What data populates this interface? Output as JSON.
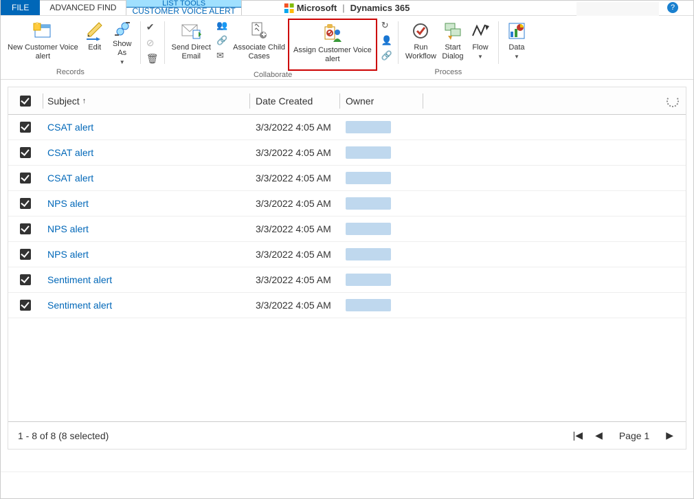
{
  "header": {
    "tabs": {
      "file": "FILE",
      "advanced_find": "ADVANCED FIND",
      "group_title": "LIST TOOLS",
      "group_sub": "CUSTOMER VOICE ALERT"
    },
    "brand": {
      "ms": "Microsoft",
      "product": "Dynamics 365"
    }
  },
  "ribbon": {
    "records": {
      "label": "Records",
      "new_alert": "New Customer Voice\nalert",
      "edit": "Edit",
      "show_as": "Show\nAs"
    },
    "collaborate": {
      "label": "Collaborate",
      "send_email": "Send Direct\nEmail",
      "assoc_child": "Associate Child\nCases",
      "assign": "Assign Customer Voice\nalert"
    },
    "process": {
      "label": "Process",
      "run_wf": "Run\nWorkflow",
      "start_dialog": "Start\nDialog",
      "flow": "Flow"
    },
    "data": {
      "label": "Data"
    }
  },
  "grid": {
    "columns": {
      "subject": "Subject",
      "date": "Date Created",
      "owner": "Owner"
    },
    "rows": [
      {
        "subject": "CSAT alert",
        "date": "3/3/2022 4:05 AM",
        "color": "#bfd8ee"
      },
      {
        "subject": "CSAT alert",
        "date": "3/3/2022 4:05 AM",
        "color": "#bfd8ee"
      },
      {
        "subject": "CSAT alert",
        "date": "3/3/2022 4:05 AM",
        "color": "#bfd8ee"
      },
      {
        "subject": "NPS alert",
        "date": "3/3/2022 4:05 AM",
        "color": "#bfd8ee"
      },
      {
        "subject": "NPS alert",
        "date": "3/3/2022 4:05 AM",
        "color": "#bfd8ee"
      },
      {
        "subject": "NPS alert",
        "date": "3/3/2022 4:05 AM",
        "color": "#bfd8ee"
      },
      {
        "subject": "Sentiment alert",
        "date": "3/3/2022 4:05 AM",
        "color": "#bfd8ee"
      },
      {
        "subject": "Sentiment alert",
        "date": "3/3/2022 4:05 AM",
        "color": "#bfd8ee"
      }
    ],
    "footer": {
      "status": "1 - 8 of 8 (8 selected)",
      "page": "Page 1"
    }
  }
}
